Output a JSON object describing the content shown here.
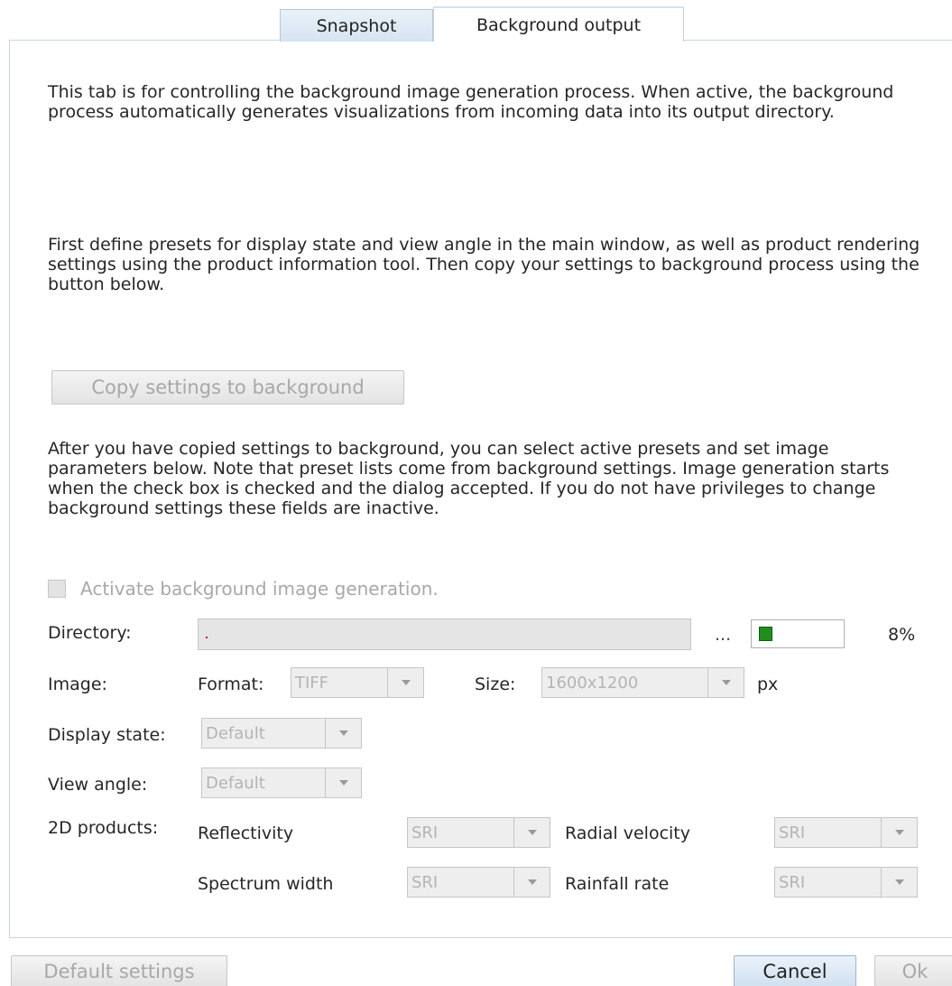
{
  "tabs": {
    "snapshot": "Snapshot",
    "background_output": "Background output"
  },
  "intro": {
    "paragraph1": "This tab is for controlling the background image generation process. When active, the background process automatically generates visualizations from incoming data into its output directory.",
    "paragraph2": "First define presets for display state and view angle in the main window, as well as product rendering settings using the product information tool. Then copy your settings to background process using the button below.",
    "paragraph3": "After you have copied settings to background, you can select active presets and set image parameters below.  Note that preset lists come from background settings. Image generation starts when the check box is checked and the dialog accepted.  If you do not have privileges to change background settings these fields are inactive."
  },
  "copy_button": "Copy settings to background",
  "activate_checkbox": {
    "label": "Activate background image generation.",
    "checked": false
  },
  "directory": {
    "label": "Directory:",
    "value": "",
    "browse": "...",
    "progress_percent": 8,
    "progress_text": "8%"
  },
  "image": {
    "label": "Image:",
    "format_label": "Format:",
    "format_value": "TIFF",
    "size_label": "Size:",
    "size_value": "1600x1200",
    "unit": "px"
  },
  "display_state": {
    "label": "Display state:",
    "value": "Default"
  },
  "view_angle": {
    "label": "View angle:",
    "value": "Default"
  },
  "products": {
    "label": "2D products:",
    "reflectivity": {
      "label": "Reflectivity",
      "value": "SRI"
    },
    "radial_velocity": {
      "label": "Radial velocity",
      "value": "SRI"
    },
    "spectrum_width": {
      "label": "Spectrum width",
      "value": "SRI"
    },
    "rainfall_rate": {
      "label": "Rainfall rate",
      "value": "SRI"
    }
  },
  "footer": {
    "default_settings": "Default settings",
    "cancel": "Cancel",
    "ok": "Ok"
  }
}
